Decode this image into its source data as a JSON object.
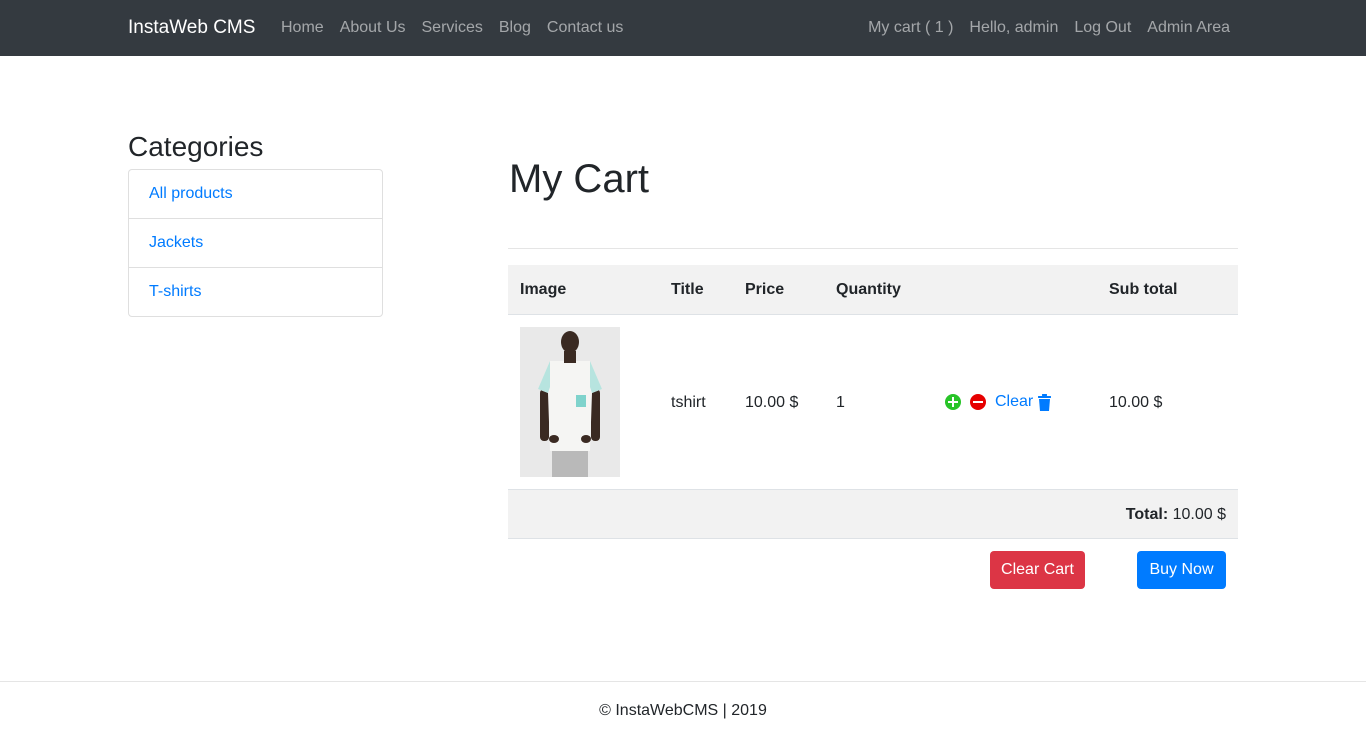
{
  "navbar": {
    "brand": "InstaWeb CMS",
    "left_links": [
      "Home",
      "About Us",
      "Services",
      "Blog",
      "Contact us"
    ],
    "right_links": [
      "My cart ( 1 )",
      "Hello, admin",
      "Log Out",
      "Admin Area"
    ]
  },
  "sidebar": {
    "title": "Categories",
    "items": [
      "All products",
      "Jackets",
      "T-shirts"
    ]
  },
  "main": {
    "title": "My Cart",
    "table": {
      "headers": [
        "Image",
        "Title",
        "Price",
        "Quantity",
        "",
        "Sub total"
      ],
      "rows": [
        {
          "image_icon": "tshirt-product-image",
          "title": "tshirt",
          "price": "10.00 $",
          "quantity": "1",
          "clear_label": "Clear",
          "subtotal": "10.00 $"
        }
      ],
      "total_label": "Total:",
      "total_value": "10.00 $"
    },
    "buttons": {
      "clear_cart": "Clear Cart",
      "buy_now": "Buy Now"
    }
  },
  "footer": {
    "text": "© InstaWebCMS | 2019"
  },
  "colors": {
    "navbar_bg": "#343a40",
    "link": "#007bff",
    "danger": "#dc3545",
    "primary": "#007bff",
    "plus_icon": "#28c428",
    "minus_icon": "#e60000"
  }
}
